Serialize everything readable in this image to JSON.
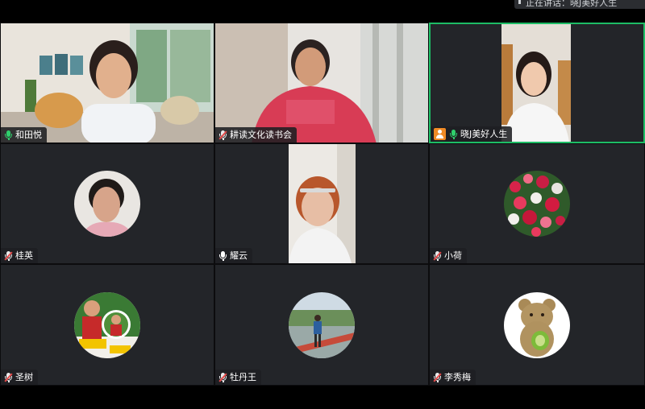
{
  "notification": {
    "text": "正在讲话：晓J美好人生"
  },
  "participants": [
    {
      "name": "和田悦",
      "mic": "on",
      "kind": "video-room",
      "host": false,
      "active": false
    },
    {
      "name": "耕读文化读书会",
      "mic": "off",
      "kind": "video-pink",
      "host": false,
      "active": false
    },
    {
      "name": "晓J美好人生",
      "mic": "on",
      "kind": "video-portrait",
      "host": true,
      "active": true
    },
    {
      "name": "桂英",
      "mic": "off",
      "kind": "avatar",
      "host": false,
      "active": false
    },
    {
      "name": "耀云",
      "mic": "on",
      "kind": "video-portrait2",
      "host": false,
      "active": false
    },
    {
      "name": "小荷",
      "mic": "off",
      "kind": "avatar-flowers",
      "host": false,
      "active": false
    },
    {
      "name": "圣树",
      "mic": "off",
      "kind": "avatar-photo",
      "host": false,
      "active": false
    },
    {
      "name": "牡丹王",
      "mic": "off",
      "kind": "avatar-outdoor",
      "host": false,
      "active": false
    },
    {
      "name": "李秀梅",
      "mic": "off",
      "kind": "avatar-bear",
      "host": false,
      "active": false
    }
  ],
  "colors": {
    "active_border": "#1dbd65",
    "mic_on": "#2fcf6c",
    "mic_off_slash": "#e44b4b",
    "host_badge": "#f08a24",
    "tile_bg": "#232529"
  }
}
